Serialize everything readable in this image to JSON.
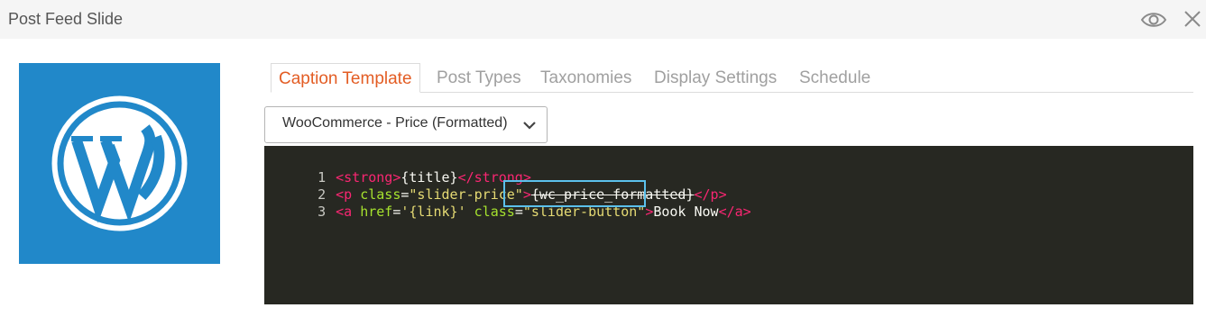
{
  "window": {
    "title": "Post Feed Slide"
  },
  "thumbnail": {
    "icon": "wordpress-logo-icon",
    "background": "#2188c9"
  },
  "tabs": [
    {
      "label": "Caption Template",
      "active": true
    },
    {
      "label": "Post Types",
      "active": false
    },
    {
      "label": "Taxonomies",
      "active": false
    },
    {
      "label": "Display Settings",
      "active": false
    },
    {
      "label": "Schedule",
      "active": false
    }
  ],
  "template_select": {
    "value": "WooCommerce - Price (Formatted)"
  },
  "editor": {
    "lines": [
      {
        "number": "1",
        "tokens": [
          "<strong>",
          "{title}",
          "</strong>"
        ]
      },
      {
        "number": "2",
        "tokens": [
          "<p",
          " class",
          "=",
          "\"slider-price\"",
          ">",
          "{wc_price_formatted}",
          "</p>"
        ]
      },
      {
        "number": "3",
        "tokens": [
          "<a",
          " href",
          "=",
          "'{link}'",
          " class",
          "=",
          "\"slider-button\"",
          ">",
          "Book Now",
          "</a>"
        ]
      }
    ]
  },
  "colors": {
    "accent": "#e35d24",
    "editor_bg": "#272822",
    "tag": "#f92672",
    "attribute": "#a6e22e",
    "string": "#e6db74",
    "highlight": "#5bc0eb"
  }
}
